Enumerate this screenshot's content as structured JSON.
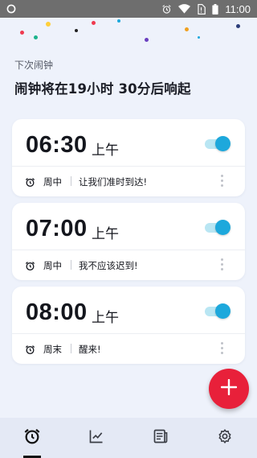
{
  "status_bar": {
    "time": "11:00",
    "icons": [
      "notification-circle-icon",
      "alarm-icon",
      "wifi-icon",
      "no-sim-icon",
      "battery-icon"
    ]
  },
  "header": {
    "label": "下次闹钟",
    "title": "闹钟将在19小时 30分后响起"
  },
  "alarms": [
    {
      "time": "06:30",
      "ampm": "上午",
      "enabled": true,
      "repeat": "周中",
      "label": "让我们准时到达!"
    },
    {
      "time": "07:00",
      "ampm": "上午",
      "enabled": true,
      "repeat": "周中",
      "label": "我不应该迟到!"
    },
    {
      "time": "08:00",
      "ampm": "上午",
      "enabled": true,
      "repeat": "周末",
      "label": "醒来!"
    }
  ],
  "fab": {
    "icon": "plus-icon"
  },
  "bottom_nav": {
    "active": "alarm",
    "items": [
      "alarm-clock-icon",
      "chart-icon",
      "news-icon",
      "gear-icon"
    ]
  },
  "colors": {
    "accent_red": "#e8203a",
    "toggle_on": "#1da8dc",
    "background": "#eef2fb",
    "status_bar": "#6e6e6e"
  }
}
